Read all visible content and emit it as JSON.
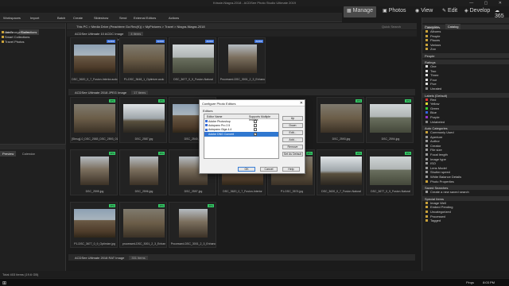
{
  "window": {
    "title": "Krissie-Niagra-2018 - ACDSee Photo Studio Ultimate 2019"
  },
  "menu": [
    "File",
    "Edit",
    "View",
    "Tools",
    "Process",
    "Help"
  ],
  "toolbar": {
    "workspaces": "Workspaces",
    "import": "Import",
    "batch": "Batch",
    "create": "Create",
    "slideshow": "Slideshow",
    "send": "Send",
    "external": "External Editors",
    "actions": "Actions"
  },
  "modes": [
    {
      "label": "Manage",
      "active": true
    },
    {
      "label": "Photos"
    },
    {
      "label": "View"
    },
    {
      "label": "Edit"
    },
    {
      "label": "Develop"
    },
    {
      "label": "365"
    }
  ],
  "left": {
    "tabs": [
      "Folders",
      "Collections"
    ],
    "items": [
      "JanGeorgeFloom",
      "Smart Collections",
      "Travel Photos"
    ],
    "preview_tabs": [
      "Preview",
      "Calendar"
    ]
  },
  "path": {
    "crumbs": "This PC  >  Media Drive (Peachtree Go:Rec(K))  >  MyPictures  >  Travel  >  Niagra-Niagra-2018",
    "search": "Quick Search"
  },
  "filter": [
    "Filter",
    "Group",
    "Sort",
    "View",
    "Select"
  ],
  "groups": [
    {
      "label": "ACDSee Ultimate 10 ACDC Image",
      "count": "4 items"
    },
    {
      "label": "ACDSee Ultimate 2018 JPEG Image",
      "count": "17 items"
    },
    {
      "label": "ACDSee Ultimate 2018 RAT Image",
      "count": "331 items"
    }
  ],
  "row1": [
    {
      "cap": "DSC_3620_0_7_Fusion-Interior.acdc",
      "badge": "ACDC"
    },
    {
      "cap": "P1-DSC_3648_1_Optimize.acdc",
      "badge": "ACDC"
    },
    {
      "cap": "DSC_3677_0_9_Fusion-Natural",
      "badge": "ACDC"
    },
    {
      "cap": "Processed-DSC_3001_2_3_Enhanc",
      "badge": "ACDC"
    }
  ],
  "row2": [
    {
      "cap": "[Shrug]-0_DSC_2583_DSC_2593_01",
      "badge": "JPG"
    },
    {
      "cap": "DSC_2587.jpg",
      "badge": "JPG"
    },
    {
      "cap": "DSC_2540.jpg",
      "badge": "JPG"
    },
    {
      "cap": "DSC_2593.jpg",
      "badge": "JPG"
    },
    {
      "cap": "DSC_2594.jpg",
      "badge": "JPG"
    }
  ],
  "row3": [
    {
      "cap": "DSC_2595.jpg",
      "badge": "JPG"
    },
    {
      "cap": "DSC_2596.jpg",
      "badge": "JPG"
    },
    {
      "cap": "DSC_2597.jpg",
      "badge": "JPG"
    },
    {
      "cap": "DSC_3620_0_7_Fusion-Interior",
      "badge": "JPG"
    },
    {
      "cap": "P1-DSC_3574.jpg",
      "badge": "JPG"
    },
    {
      "cap": "DSC_3620_0_7_Fusion-Natural",
      "badge": "JPG"
    },
    {
      "cap": "DSC_3677_0_9_Fusion-Natural",
      "badge": "JPG"
    }
  ],
  "row4": [
    {
      "cap": "P1-DSC_3677_0_9_Optimize.jpg",
      "badge": "JPG"
    },
    {
      "cap": "processed-DSC_3001_2_3_Enhan",
      "badge": "JPG"
    },
    {
      "cap": "Processed-DSC_3001_2_3_Enhanc",
      "badge": "JPG"
    }
  ],
  "right": {
    "tabs": [
      "Properties",
      "Catalog"
    ],
    "sections": [
      {
        "title": "Categories",
        "items": [
          {
            "l": "Albums",
            "c": "#c9a23a"
          },
          {
            "l": "People",
            "c": "#c9a23a"
          },
          {
            "l": "Places",
            "c": "#c9a23a"
          },
          {
            "l": "Various",
            "c": "#c9a23a"
          },
          {
            "l": "Zoo",
            "c": "#c9a23a"
          }
        ]
      },
      {
        "title": "People",
        "items": []
      },
      {
        "title": "Ratings",
        "items": [
          {
            "l": "One",
            "c": "#ddd"
          },
          {
            "l": "Two",
            "c": "#ddd"
          },
          {
            "l": "Three",
            "c": "#ddd"
          },
          {
            "l": "Four",
            "c": "#ddd"
          },
          {
            "l": "Five",
            "c": "#ddd"
          },
          {
            "l": "Unrated",
            "c": "#888"
          }
        ]
      },
      {
        "title": "Labels (Default)",
        "items": [
          {
            "l": "Red",
            "c": "#d33"
          },
          {
            "l": "Yellow",
            "c": "#dd3"
          },
          {
            "l": "Green",
            "c": "#3c3"
          },
          {
            "l": "Blue",
            "c": "#36d"
          },
          {
            "l": "Purple",
            "c": "#93c"
          },
          {
            "l": "Unlabeled",
            "c": "#888"
          }
        ]
      },
      {
        "title": "Auto Categories",
        "items": [
          {
            "l": "Commonly Used",
            "c": "#c9a23a"
          },
          {
            "l": "Aperture",
            "c": "#999"
          },
          {
            "l": "Author",
            "c": "#999"
          },
          {
            "l": "Creator",
            "c": "#999"
          },
          {
            "l": "File size",
            "c": "#999"
          },
          {
            "l": "Focal length",
            "c": "#999"
          },
          {
            "l": "Image type",
            "c": "#999"
          },
          {
            "l": "ISO",
            "c": "#999"
          },
          {
            "l": "Lens Model",
            "c": "#999"
          },
          {
            "l": "Shutter speed",
            "c": "#999"
          },
          {
            "l": "White Balance Details",
            "c": "#999"
          },
          {
            "l": "Photo Properties",
            "c": "#c9a23a"
          }
        ]
      },
      {
        "title": "Saved Searches",
        "items": [
          {
            "l": "Create a new saved search",
            "c": "#999"
          }
        ]
      },
      {
        "title": "Special Items",
        "items": [
          {
            "l": "Image Well",
            "c": "#c9a23a"
          },
          {
            "l": "Embed Pending",
            "c": "#c9a23a"
          },
          {
            "l": "Uncategorized",
            "c": "#c9a23a"
          },
          {
            "l": "Processed",
            "c": "#c9a23a"
          },
          {
            "l": "Tagged",
            "c": "#c9a23a"
          }
        ]
      }
    ]
  },
  "status": "Total 403 items (19.6 GB)",
  "taskbar": {
    "clock": "8:03 PM",
    "time_label": "Pings"
  },
  "dialog": {
    "title": "Configure Photo Editors",
    "group": "Editors",
    "col1": "Editor Name",
    "col2": "Supports Multiple Images",
    "editors": [
      {
        "name": "Adobe Photoshop",
        "multi": "",
        "sel": false
      },
      {
        "name": "Autopano Pro 2.5",
        "multi": "",
        "sel": false
      },
      {
        "name": "Autopano Giga 4.4",
        "multi": "",
        "sel": false
      },
      {
        "name": "Adobe DNG Convert",
        "multi": "✓",
        "sel": true
      }
    ],
    "buttons": {
      "up": "Up",
      "down": "Down",
      "edit": "Edit...",
      "add": "Add...",
      "remove": "Remove",
      "default": "Set As Default",
      "ok": "OK",
      "cancel": "Cancel",
      "help": "Help"
    }
  }
}
